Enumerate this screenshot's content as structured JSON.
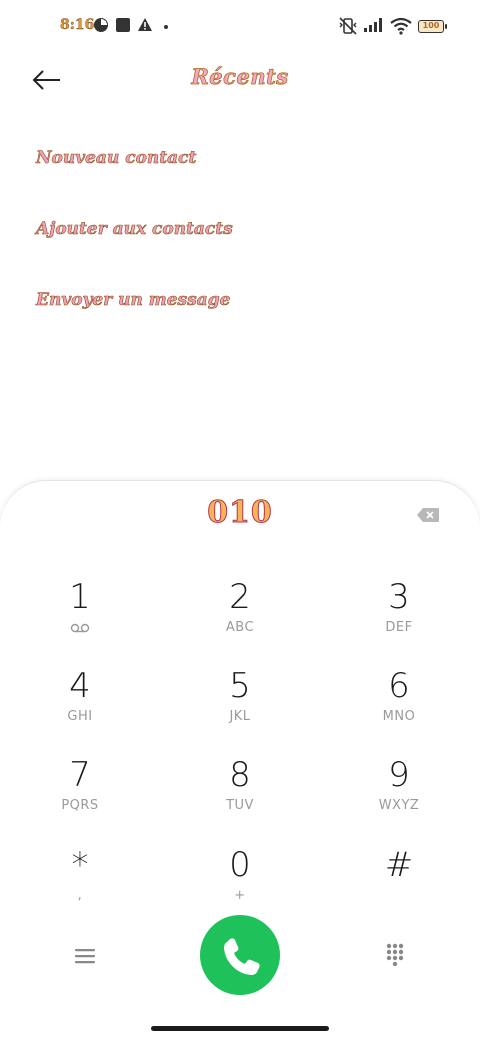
{
  "status_bar": {
    "time": "8:16",
    "battery": "100",
    "icons": [
      "app-circle-icon",
      "square-app-icon",
      "warning-icon",
      "vibrate-off-icon",
      "signal-icon",
      "wifi-icon",
      "battery-icon"
    ]
  },
  "header": {
    "title": "Récents",
    "back_icon": "back-arrow-icon"
  },
  "menu": {
    "items": [
      {
        "label": "Nouveau contact"
      },
      {
        "label": "Ajouter aux contacts"
      },
      {
        "label": "Envoyer un message"
      }
    ]
  },
  "dialpad": {
    "number": "010",
    "keys": [
      {
        "digit": "1",
        "letters": ""
      },
      {
        "digit": "2",
        "letters": "ABC"
      },
      {
        "digit": "3",
        "letters": "DEF"
      },
      {
        "digit": "4",
        "letters": "GHI"
      },
      {
        "digit": "5",
        "letters": "JKL"
      },
      {
        "digit": "6",
        "letters": "MNO"
      },
      {
        "digit": "7",
        "letters": "PQRS"
      },
      {
        "digit": "8",
        "letters": "TUV"
      },
      {
        "digit": "9",
        "letters": "WXYZ"
      },
      {
        "digit": "*",
        "letters": ","
      },
      {
        "digit": "0",
        "letters": "+"
      },
      {
        "digit": "#",
        "letters": ""
      }
    ]
  },
  "colors": {
    "call_button": "#1ec15a",
    "accent_text": "#f2a0b8"
  }
}
